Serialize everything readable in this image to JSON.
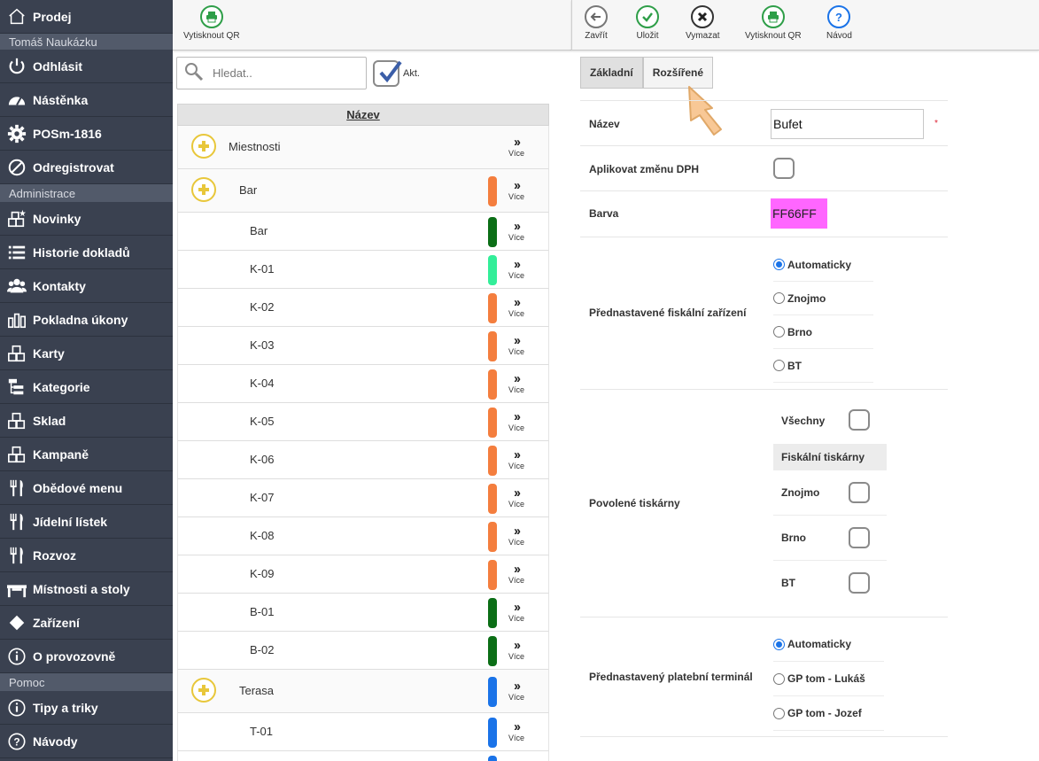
{
  "sidebar": {
    "top_item": {
      "label": "Prodej",
      "icon": "home-icon"
    },
    "user_section": "Tomáš Naukázku",
    "user_items": [
      {
        "label": "Odhlásit",
        "icon": "power-icon"
      },
      {
        "label": "Nástěnka",
        "icon": "dashboard-icon"
      },
      {
        "label": "POSm-1816",
        "icon": "gear-icon"
      },
      {
        "label": "Odregistrovat",
        "icon": "ban-icon"
      }
    ],
    "admin_section": "Administrace",
    "admin_items": [
      {
        "label": "Novinky",
        "icon": "blocks-star-icon"
      },
      {
        "label": "Historie dokladů",
        "icon": "list-icon"
      },
      {
        "label": "Kontakty",
        "icon": "users-icon"
      },
      {
        "label": "Pokladna úkony",
        "icon": "bar-chart-icon"
      },
      {
        "label": "Karty",
        "icon": "blocks-icon"
      },
      {
        "label": "Kategorie",
        "icon": "tree-icon"
      },
      {
        "label": "Sklad",
        "icon": "blocks-icon"
      },
      {
        "label": "Kampaně",
        "icon": "blocks-icon"
      },
      {
        "label": "Obědové menu",
        "icon": "cutlery-icon"
      },
      {
        "label": "Jídelní lístek",
        "icon": "cutlery-icon"
      },
      {
        "label": "Rozvoz",
        "icon": "cutlery-icon"
      },
      {
        "label": "Místnosti a stoly",
        "icon": "table-icon"
      },
      {
        "label": "Zařízení",
        "icon": "diamond-icon"
      },
      {
        "label": "O provozovně",
        "icon": "info-icon"
      }
    ],
    "help_section": "Pomoc",
    "help_items": [
      {
        "label": "Tipy a triky",
        "icon": "info-icon"
      },
      {
        "label": "Návody",
        "icon": "question-icon"
      }
    ]
  },
  "toolbar_left": {
    "print_qr": "Vytisknout QR"
  },
  "toolbar_right": {
    "close": "Zavřít",
    "save": "Uložit",
    "delete": "Vymazat",
    "print_qr": "Vytisknout QR",
    "guide": "Návod"
  },
  "search": {
    "placeholder": "Hledat..",
    "akt_label": "Akt."
  },
  "list": {
    "header": "Název",
    "more_label": "Více",
    "rows": [
      {
        "label": "Miestnosti",
        "level": 0,
        "group": true,
        "color": null
      },
      {
        "label": "Bar",
        "level": 1,
        "group": true,
        "color": "#f47e3e"
      },
      {
        "label": "Bar",
        "level": 2,
        "group": false,
        "color": "#0b6e16"
      },
      {
        "label": "K-01",
        "level": 2,
        "group": false,
        "color": "#33ee99"
      },
      {
        "label": "K-02",
        "level": 2,
        "group": false,
        "color": "#f47e3e"
      },
      {
        "label": "K-03",
        "level": 2,
        "group": false,
        "color": "#f47e3e"
      },
      {
        "label": "K-04",
        "level": 2,
        "group": false,
        "color": "#f47e3e"
      },
      {
        "label": "K-05",
        "level": 2,
        "group": false,
        "color": "#f47e3e"
      },
      {
        "label": "K-06",
        "level": 2,
        "group": false,
        "color": "#f47e3e"
      },
      {
        "label": "K-07",
        "level": 2,
        "group": false,
        "color": "#f47e3e"
      },
      {
        "label": "K-08",
        "level": 2,
        "group": false,
        "color": "#f47e3e"
      },
      {
        "label": "K-09",
        "level": 2,
        "group": false,
        "color": "#f47e3e"
      },
      {
        "label": "B-01",
        "level": 2,
        "group": false,
        "color": "#0b6e16"
      },
      {
        "label": "B-02",
        "level": 2,
        "group": false,
        "color": "#0b6e16"
      },
      {
        "label": "Terasa",
        "level": 1,
        "group": true,
        "color": "#1a73e8"
      },
      {
        "label": "T-01",
        "level": 2,
        "group": false,
        "color": "#1a73e8"
      },
      {
        "label": "",
        "level": 2,
        "group": false,
        "color": "#1a73e8"
      }
    ]
  },
  "tabs": [
    {
      "label": "Základní",
      "active": true
    },
    {
      "label": "Rozšířené",
      "active": false
    }
  ],
  "form": {
    "name": {
      "label": "Název",
      "value": "Bufet",
      "required": "*"
    },
    "vat": {
      "label": "Aplikovat změnu DPH"
    },
    "color": {
      "label": "Barva",
      "value": "FF66FF",
      "swatch": "#ff66ff"
    },
    "fiscal": {
      "label": "Přednastavené fiskální zařízení",
      "options": [
        "Automaticky",
        "Znojmo",
        "Brno",
        "BT"
      ],
      "selected": "Automaticky"
    },
    "printers": {
      "label": "Povolené tiskárny",
      "all_label": "Všechny",
      "group_header": "Fiskální tiskárny",
      "items": [
        "Znojmo",
        "Brno",
        "BT"
      ]
    },
    "terminal": {
      "label": "Přednastavený platební terminál",
      "options": [
        "Automaticky",
        "GP tom - Lukáš",
        "GP tom - Jozef"
      ],
      "selected": "Automaticky"
    }
  },
  "colors": {
    "sidebar": "#3a4150",
    "section": "#525a6a",
    "accent_green": "#2e9e48",
    "accent_blue": "#1a73e8"
  }
}
